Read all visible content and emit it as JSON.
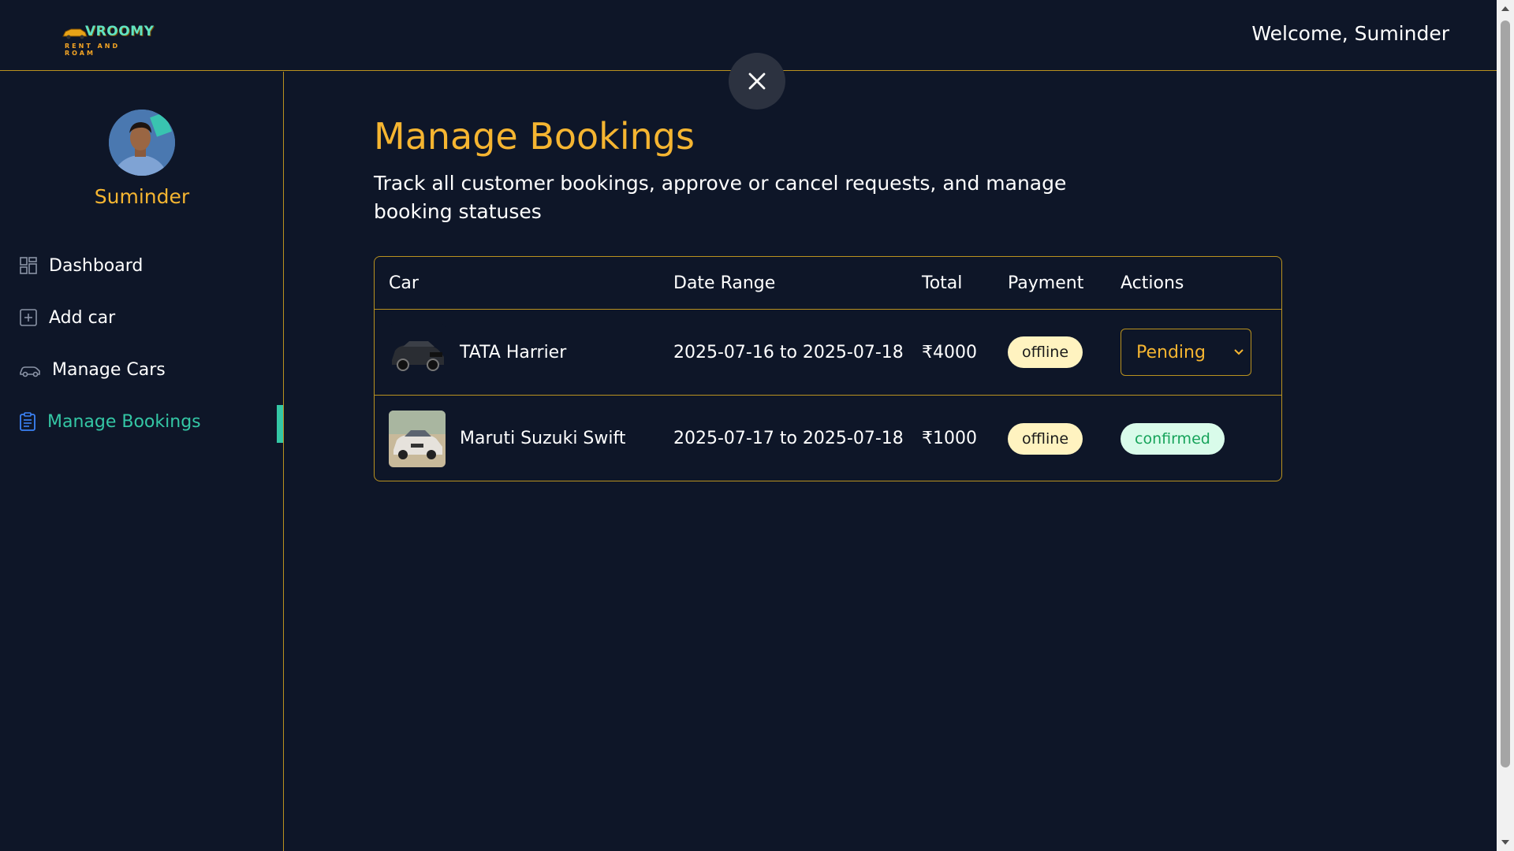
{
  "header": {
    "logo_text": "VROOMY",
    "logo_sub": "RENT AND ROAM",
    "welcome": "Welcome, Suminder"
  },
  "sidebar": {
    "username": "Suminder",
    "items": [
      {
        "label": "Dashboard",
        "icon": "dashboard-grid-icon"
      },
      {
        "label": "Add car",
        "icon": "plus-square-icon"
      },
      {
        "label": "Manage Cars",
        "icon": "car-icon"
      },
      {
        "label": "Manage Bookings",
        "icon": "clipboard-list-icon",
        "active": true
      }
    ]
  },
  "main": {
    "title": "Manage Bookings",
    "description": "Track all customer bookings, approve or cancel requests, and manage booking statuses",
    "table": {
      "headers": [
        "Car",
        "Date Range",
        "Total",
        "Payment",
        "Actions"
      ],
      "rows": [
        {
          "car": "TATA Harrier",
          "date_range": "2025-07-16 to 2025-07-18",
          "total": "₹4000",
          "payment": "offline",
          "action": "Pending",
          "action_type": "select"
        },
        {
          "car": "Maruti Suzuki Swift",
          "date_range": "2025-07-17 to 2025-07-18",
          "total": "₹1000",
          "payment": "offline",
          "action": "confirmed",
          "action_type": "badge"
        }
      ]
    }
  },
  "colors": {
    "background": "#0e1628",
    "accent": "#f5b531",
    "border": "#b9921f",
    "active": "#34c7a5"
  }
}
